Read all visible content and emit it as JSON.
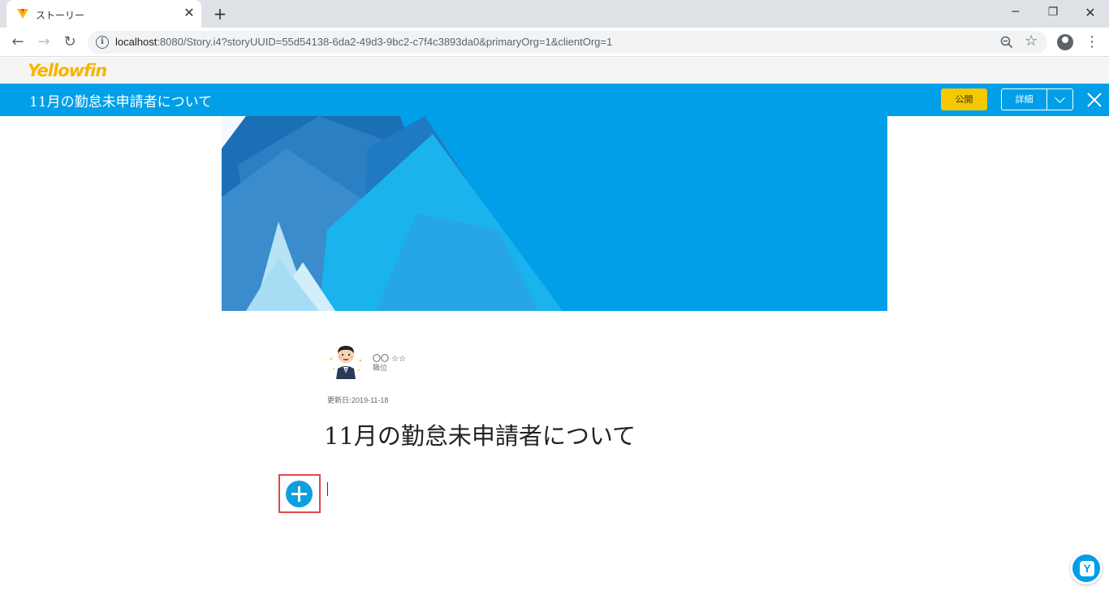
{
  "browser": {
    "tab_title": "ストーリー",
    "tab_close": "✕",
    "new_tab": "+",
    "url_host": "localhost",
    "url_rest": ":8080/Story.i4?storyUUID=55d54138-6da2-49d3-9bc2-c7f4c3893da0&primaryOrg=1&clientOrg=1",
    "window": {
      "minimize": "─",
      "maximize": "❐",
      "close": "✕"
    }
  },
  "app": {
    "logo_text": "Yellowfin",
    "story_title": "11月の勤怠未申請者について",
    "publish_label": "公開",
    "detail_label": "詳細"
  },
  "story": {
    "author_name": "〇〇 ☆☆",
    "author_role": "職位",
    "updated_label": "更新日:",
    "updated_value": "2019-11-18",
    "title": "11月の勤怠未申請者について"
  },
  "assist_label": "Y",
  "colors": {
    "accent": "#009fe8",
    "publish": "#f6c800",
    "highlight": "#e0454f"
  }
}
